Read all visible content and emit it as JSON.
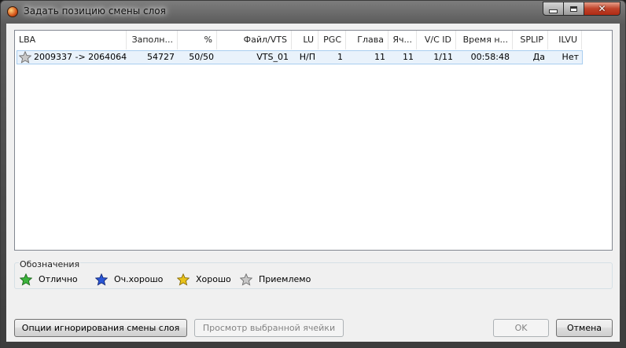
{
  "window": {
    "title": "Задать позицию смены слоя"
  },
  "table": {
    "columns": [
      "LBA",
      "Заполн...",
      "%",
      "Файл/VTS",
      "LU",
      "PGC",
      "Глава",
      "Яч...",
      "V/C ID",
      "Время н...",
      "SPLIP",
      "ILVU"
    ],
    "rows": [
      {
        "rating_icon": "star-gray-icon",
        "cells": [
          "2009337 -> 2064064",
          "54727",
          "50/50",
          "VTS_01",
          "Н/П",
          "1",
          "11",
          "11",
          "1/11",
          "00:58:48",
          "Да",
          "Нет"
        ]
      }
    ]
  },
  "legend": {
    "title": "Обозначения",
    "items": [
      {
        "label": "Отлично",
        "icon": "star-green-icon",
        "color": "#3cb43c"
      },
      {
        "label": "Оч.хорошо",
        "icon": "star-blue-icon",
        "color": "#2a56d6"
      },
      {
        "label": "Хорошо",
        "icon": "star-yellow-icon",
        "color": "#e8c21a"
      },
      {
        "label": "Приемлемо",
        "icon": "star-gray-icon",
        "color": "#c8c8c8"
      }
    ]
  },
  "buttons": {
    "ignore_options": "Опции игнорирования смены слоя",
    "view_cell": "Просмотр выбранной ячейки",
    "ok": "OK",
    "cancel": "Отмена"
  }
}
